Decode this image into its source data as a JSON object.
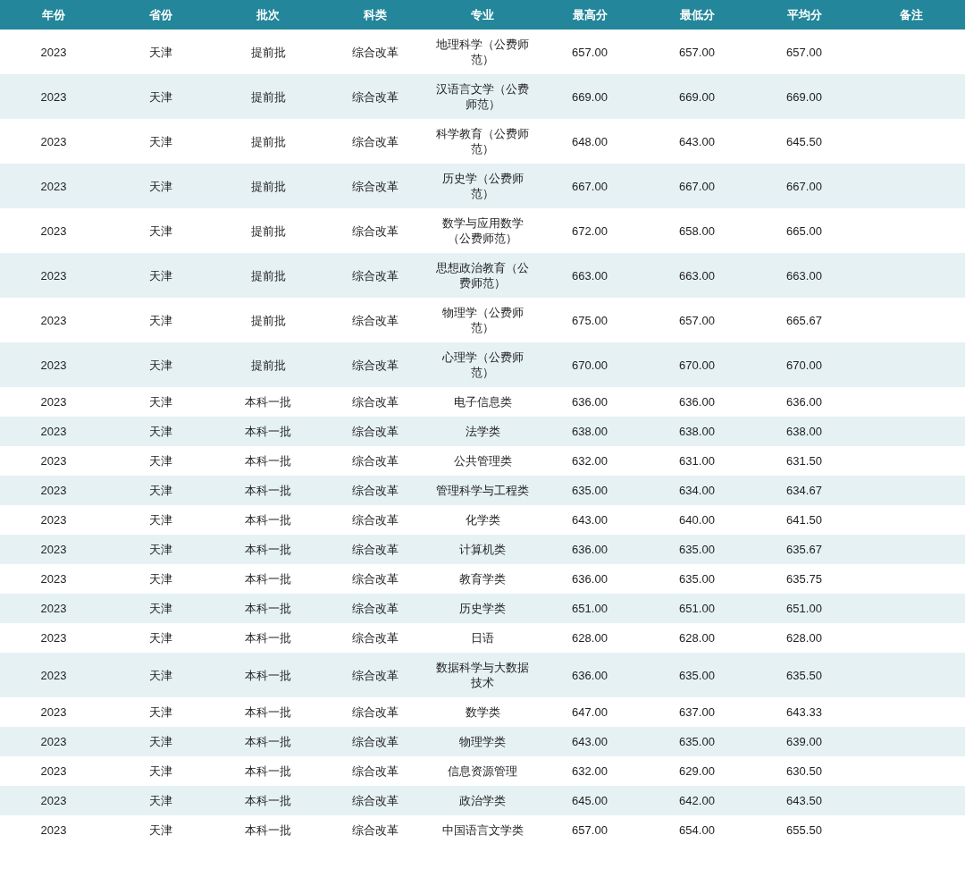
{
  "table": {
    "columns": [
      "年份",
      "省份",
      "批次",
      "科类",
      "专业",
      "最高分",
      "最低分",
      "平均分",
      "备注"
    ],
    "rows": [
      [
        "2023",
        "天津",
        "提前批",
        "综合改革",
        "地理科学（公费师范）",
        "657.00",
        "657.00",
        "657.00"
      ],
      [
        "2023",
        "天津",
        "提前批",
        "综合改革",
        "汉语言文学（公费师范）",
        "669.00",
        "669.00",
        "669.00"
      ],
      [
        "2023",
        "天津",
        "提前批",
        "综合改革",
        "科学教育（公费师范）",
        "648.00",
        "643.00",
        "645.50"
      ],
      [
        "2023",
        "天津",
        "提前批",
        "综合改革",
        "历史学（公费师范）",
        "667.00",
        "667.00",
        "667.00"
      ],
      [
        "2023",
        "天津",
        "提前批",
        "综合改革",
        "数学与应用数学（公费师范）",
        "672.00",
        "658.00",
        "665.00"
      ],
      [
        "2023",
        "天津",
        "提前批",
        "综合改革",
        "思想政治教育（公费师范）",
        "663.00",
        "663.00",
        "663.00"
      ],
      [
        "2023",
        "天津",
        "提前批",
        "综合改革",
        "物理学（公费师范）",
        "675.00",
        "657.00",
        "665.67"
      ],
      [
        "2023",
        "天津",
        "提前批",
        "综合改革",
        "心理学（公费师范）",
        "670.00",
        "670.00",
        "670.00"
      ],
      [
        "2023",
        "天津",
        "本科一批",
        "综合改革",
        "电子信息类",
        "636.00",
        "636.00",
        "636.00"
      ],
      [
        "2023",
        "天津",
        "本科一批",
        "综合改革",
        "法学类",
        "638.00",
        "638.00",
        "638.00"
      ],
      [
        "2023",
        "天津",
        "本科一批",
        "综合改革",
        "公共管理类",
        "632.00",
        "631.00",
        "631.50"
      ],
      [
        "2023",
        "天津",
        "本科一批",
        "综合改革",
        "管理科学与工程类",
        "635.00",
        "634.00",
        "634.67"
      ],
      [
        "2023",
        "天津",
        "本科一批",
        "综合改革",
        "化学类",
        "643.00",
        "640.00",
        "641.50"
      ],
      [
        "2023",
        "天津",
        "本科一批",
        "综合改革",
        "计算机类",
        "636.00",
        "635.00",
        "635.67"
      ],
      [
        "2023",
        "天津",
        "本科一批",
        "综合改革",
        "教育学类",
        "636.00",
        "635.00",
        "635.75"
      ],
      [
        "2023",
        "天津",
        "本科一批",
        "综合改革",
        "历史学类",
        "651.00",
        "651.00",
        "651.00"
      ],
      [
        "2023",
        "天津",
        "本科一批",
        "综合改革",
        "日语",
        "628.00",
        "628.00",
        "628.00"
      ],
      [
        "2023",
        "天津",
        "本科一批",
        "综合改革",
        "数据科学与大数据技术",
        "636.00",
        "635.00",
        "635.50"
      ],
      [
        "2023",
        "天津",
        "本科一批",
        "综合改革",
        "数学类",
        "647.00",
        "637.00",
        "643.33"
      ],
      [
        "2023",
        "天津",
        "本科一批",
        "综合改革",
        "物理学类",
        "643.00",
        "635.00",
        "639.00"
      ],
      [
        "2023",
        "天津",
        "本科一批",
        "综合改革",
        "信息资源管理",
        "632.00",
        "629.00",
        "630.50"
      ],
      [
        "2023",
        "天津",
        "本科一批",
        "综合改革",
        "政治学类",
        "645.00",
        "642.00",
        "643.50"
      ],
      [
        "2023",
        "天津",
        "本科一批",
        "综合改革",
        "中国语言文学类",
        "657.00",
        "654.00",
        "655.50"
      ]
    ]
  }
}
